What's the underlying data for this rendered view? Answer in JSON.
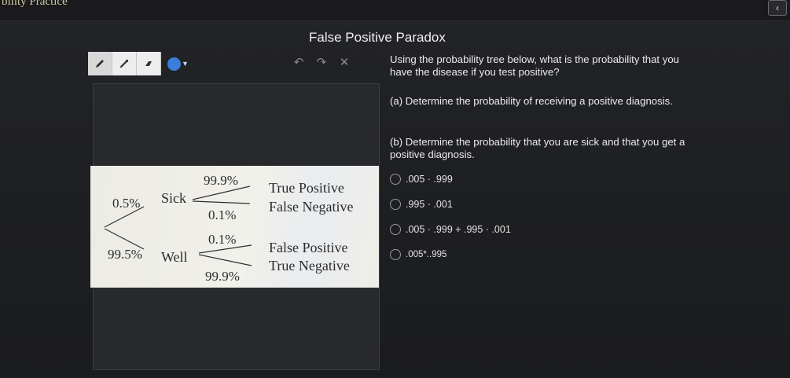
{
  "header": {
    "app_title": "bility Practice",
    "collapse_icon": "chevron-left-icon"
  },
  "heading": "False Positive Paradox",
  "toolbar": {
    "tools": [
      "pencil-icon",
      "pen-icon",
      "eraser-icon"
    ],
    "color": "#3b7ddd",
    "history": [
      "undo-icon",
      "redo-icon",
      "clear-icon"
    ]
  },
  "tree": {
    "sick_prob": "0.5%",
    "sick_label": "Sick",
    "well_prob": "99.5%",
    "well_label": "Well",
    "sick_pos": "99.9%",
    "sick_neg": "0.1%",
    "well_pos": "0.1%",
    "well_neg": "99.9%",
    "true_positive": "True Positive",
    "false_negative": "False Negative",
    "false_positive": "False Positive",
    "true_negative": "True Negative"
  },
  "question": "Using the probability tree below, what is the probability that you have the disease if you test positive?",
  "part_a": "(a) Determine the probability of receiving a positive diagnosis.",
  "part_b": "(b) Determine the probability that you are sick and that you get a positive diagnosis.",
  "options": [
    ".005 · .999",
    ".995 · .001",
    ".005 · .999 + .995 · .001",
    ".005*..995"
  ]
}
